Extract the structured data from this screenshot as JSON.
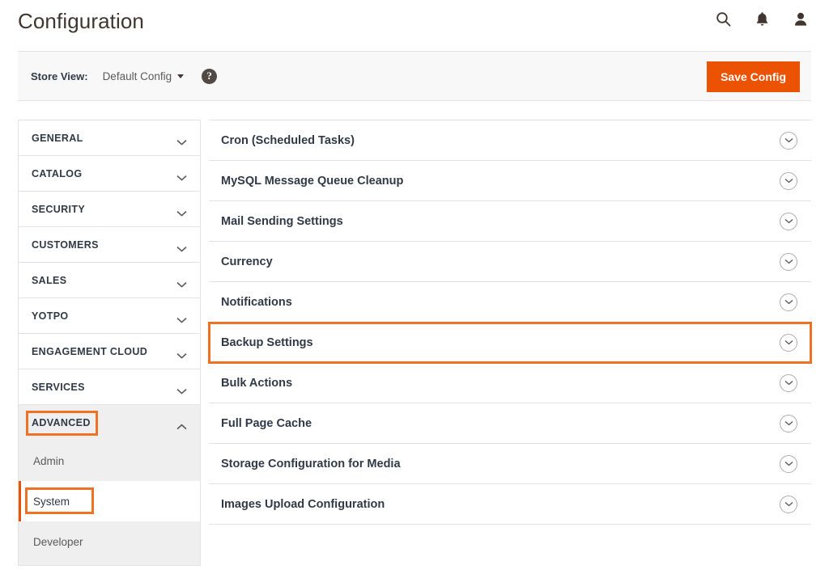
{
  "header": {
    "title": "Configuration",
    "icons": [
      {
        "name": "search-icon",
        "glyph": "search"
      },
      {
        "name": "notifications-bell-icon",
        "glyph": "bell"
      },
      {
        "name": "user-account-icon",
        "glyph": "user"
      }
    ]
  },
  "storeview": {
    "label": "Store View:",
    "value": "Default Config",
    "help": "?",
    "save_label": "Save Config"
  },
  "sidebar": {
    "sections": [
      {
        "label": "GENERAL",
        "expanded": false
      },
      {
        "label": "CATALOG",
        "expanded": false
      },
      {
        "label": "SECURITY",
        "expanded": false
      },
      {
        "label": "CUSTOMERS",
        "expanded": false
      },
      {
        "label": "SALES",
        "expanded": false
      },
      {
        "label": "YOTPO",
        "expanded": false
      },
      {
        "label": "ENGAGEMENT CLOUD",
        "expanded": false
      },
      {
        "label": "SERVICES",
        "expanded": false
      },
      {
        "label": "ADVANCED",
        "expanded": true
      }
    ],
    "submenu": [
      {
        "label": "Admin",
        "current": false
      },
      {
        "label": "System",
        "current": true
      },
      {
        "label": "Developer",
        "current": false
      }
    ]
  },
  "main": {
    "rows": [
      {
        "title": "Cron (Scheduled Tasks)",
        "highlighted": false
      },
      {
        "title": "MySQL Message Queue Cleanup",
        "highlighted": false
      },
      {
        "title": "Mail Sending Settings",
        "highlighted": false
      },
      {
        "title": "Currency",
        "highlighted": false
      },
      {
        "title": "Notifications",
        "highlighted": false
      },
      {
        "title": "Backup Settings",
        "highlighted": true
      },
      {
        "title": "Bulk Actions",
        "highlighted": false
      },
      {
        "title": "Full Page Cache",
        "highlighted": false
      },
      {
        "title": "Storage Configuration for Media",
        "highlighted": false
      },
      {
        "title": "Images Upload Configuration",
        "highlighted": false
      }
    ]
  },
  "colors": {
    "accent_orange": "#eb5202",
    "annotation_orange": "#ef7126",
    "text_dark": "#303a47",
    "panel_border": "#e3e3e3",
    "submenu_bg": "#efefef"
  }
}
